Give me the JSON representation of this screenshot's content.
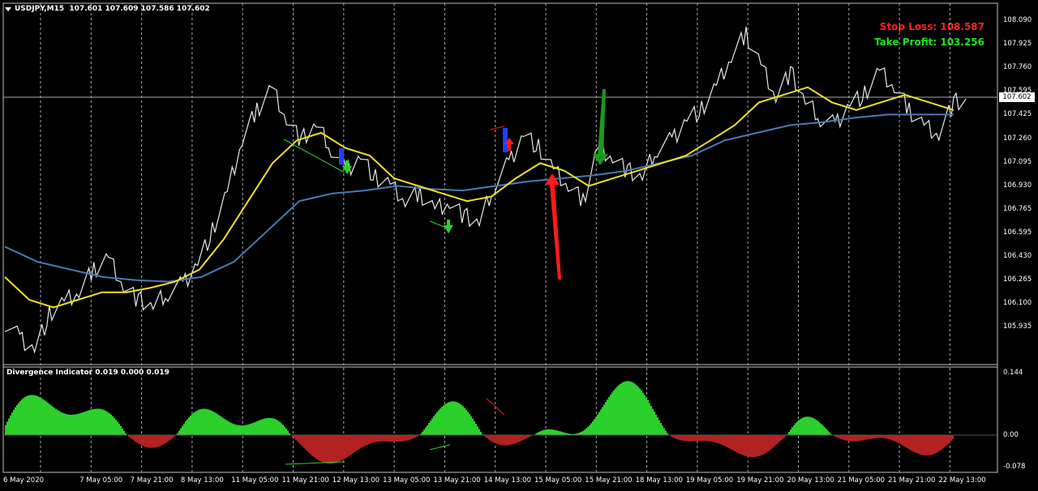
{
  "header": {
    "symbol": "USDJPY,M15",
    "quote": "107.601 107.609 107.586 107.602"
  },
  "annotations": {
    "stop_loss": "Stop Loss: 108.587",
    "take_profit": "Take Profit: 103.256"
  },
  "indicator": {
    "title": "Divergence Indicator 0.019 0.000 0.019",
    "scale": [
      "0.144",
      "0.00",
      "-0.078"
    ]
  },
  "current_price": "107.602",
  "price_scale": [
    "108.090",
    "107.925",
    "107.760",
    "107.595",
    "107.425",
    "107.260",
    "107.095",
    "106.930",
    "106.765",
    "106.595",
    "106.430",
    "106.265",
    "106.100",
    "105.935"
  ],
  "time_scale": [
    "6 May 2020",
    "7 May 05:00",
    "7 May 21:00",
    "8 May 13:00",
    "11 May 05:00",
    "11 May 21:00",
    "12 May 13:00",
    "13 May 05:00",
    "13 May 21:00",
    "14 May 13:00",
    "15 May 05:00",
    "15 May 21:00",
    "18 May 13:00",
    "19 May 05:00",
    "19 May 21:00",
    "20 May 13:00",
    "21 May 05:00",
    "21 May 21:00",
    "22 May 13:00"
  ],
  "colors": {
    "bull": "#2bd02b",
    "bear": "#b22222",
    "ma_fast": "#f0e020",
    "ma_slow": "#4a7ab5",
    "stop": "#ff2020",
    "take": "#19e619"
  },
  "chart_data": {
    "type": "line",
    "title": "USDJPY,M15",
    "ylim": [
      105.9,
      108.2
    ],
    "grid": true,
    "series": [
      {
        "values": [
          106.15,
          106.05,
          105.98,
          106.2,
          106.28,
          106.35,
          106.5,
          106.58,
          106.4,
          106.3,
          106.25,
          106.35,
          106.4,
          106.55,
          106.75,
          107.0,
          107.35,
          107.55,
          107.7,
          107.5,
          107.35,
          107.45,
          107.3,
          107.15,
          107.25,
          107.1,
          107.05,
          106.95,
          107.0,
          106.9,
          106.95,
          106.85,
          106.8,
          107.05,
          107.2,
          107.4,
          107.3,
          107.15,
          107.05,
          106.95,
          107.3,
          107.25,
          107.15,
          107.1,
          107.3,
          107.35,
          107.5,
          107.55,
          107.7,
          107.9,
          108.05,
          107.85,
          107.65,
          107.8,
          107.6,
          107.5,
          107.45,
          107.6,
          107.65,
          107.8,
          107.7,
          107.55,
          107.45,
          107.4,
          107.6
        ]
      },
      {
        "values": [
          106.45,
          106.3,
          106.25,
          106.3,
          106.35,
          106.35,
          106.38,
          106.42,
          106.5,
          106.7,
          106.95,
          107.2,
          107.35,
          107.4,
          107.3,
          107.25,
          107.1,
          107.05,
          107.0,
          106.95,
          106.98,
          107.1,
          107.2,
          107.15,
          107.05,
          107.1,
          107.15,
          107.2,
          107.25,
          107.35,
          107.45,
          107.6,
          107.65,
          107.7,
          107.6,
          107.55,
          107.6,
          107.65,
          107.6,
          107.55
        ]
      },
      {
        "values": [
          106.65,
          106.55,
          106.5,
          106.45,
          106.43,
          106.42,
          106.45,
          106.55,
          106.75,
          106.95,
          107.0,
          107.02,
          107.05,
          107.03,
          107.02,
          107.05,
          107.08,
          107.1,
          107.12,
          107.15,
          107.2,
          107.25,
          107.35,
          107.4,
          107.45,
          107.47,
          107.5,
          107.52,
          107.52,
          107.52
        ]
      }
    ]
  }
}
